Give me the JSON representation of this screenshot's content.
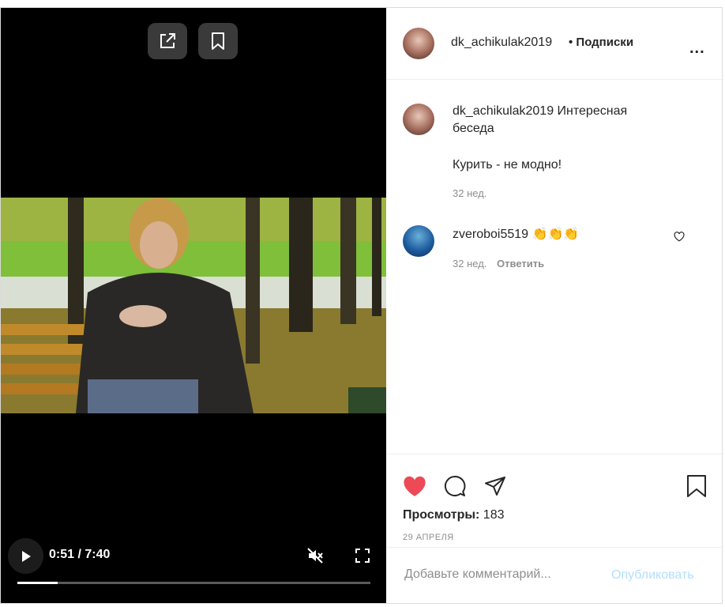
{
  "video": {
    "time_display": "0:51 / 7:40",
    "progress_fraction": 0.114
  },
  "post": {
    "username": "dk_achikulak2019",
    "follow_label": "• Подписки",
    "more_label": "...",
    "caption_title": "Интересная беседа",
    "caption_body": "Курить - не модно!",
    "caption_age": "32 нед."
  },
  "comments": [
    {
      "username": "zveroboi5519",
      "emoji": "👏👏👏",
      "age": "32 нед.",
      "reply_label": "Ответить"
    }
  ],
  "stats": {
    "views_label": "Просмотры:",
    "views_count": "183",
    "date": "29 АПРЕЛЯ"
  },
  "composer": {
    "placeholder": "Добавьте комментарий...",
    "publish_label": "Опубликовать"
  },
  "colors": {
    "like": "#ed4956",
    "publish": "#b2dffc"
  },
  "icons": {
    "share": "share-external-icon",
    "save": "bookmark-icon",
    "play": "play-icon",
    "mute": "muted-speaker-icon",
    "fullscreen": "fullscreen-icon",
    "like": "heart-icon",
    "comment": "comment-bubble-icon",
    "direct": "paper-plane-icon",
    "comment_like": "heart-outline-icon"
  }
}
